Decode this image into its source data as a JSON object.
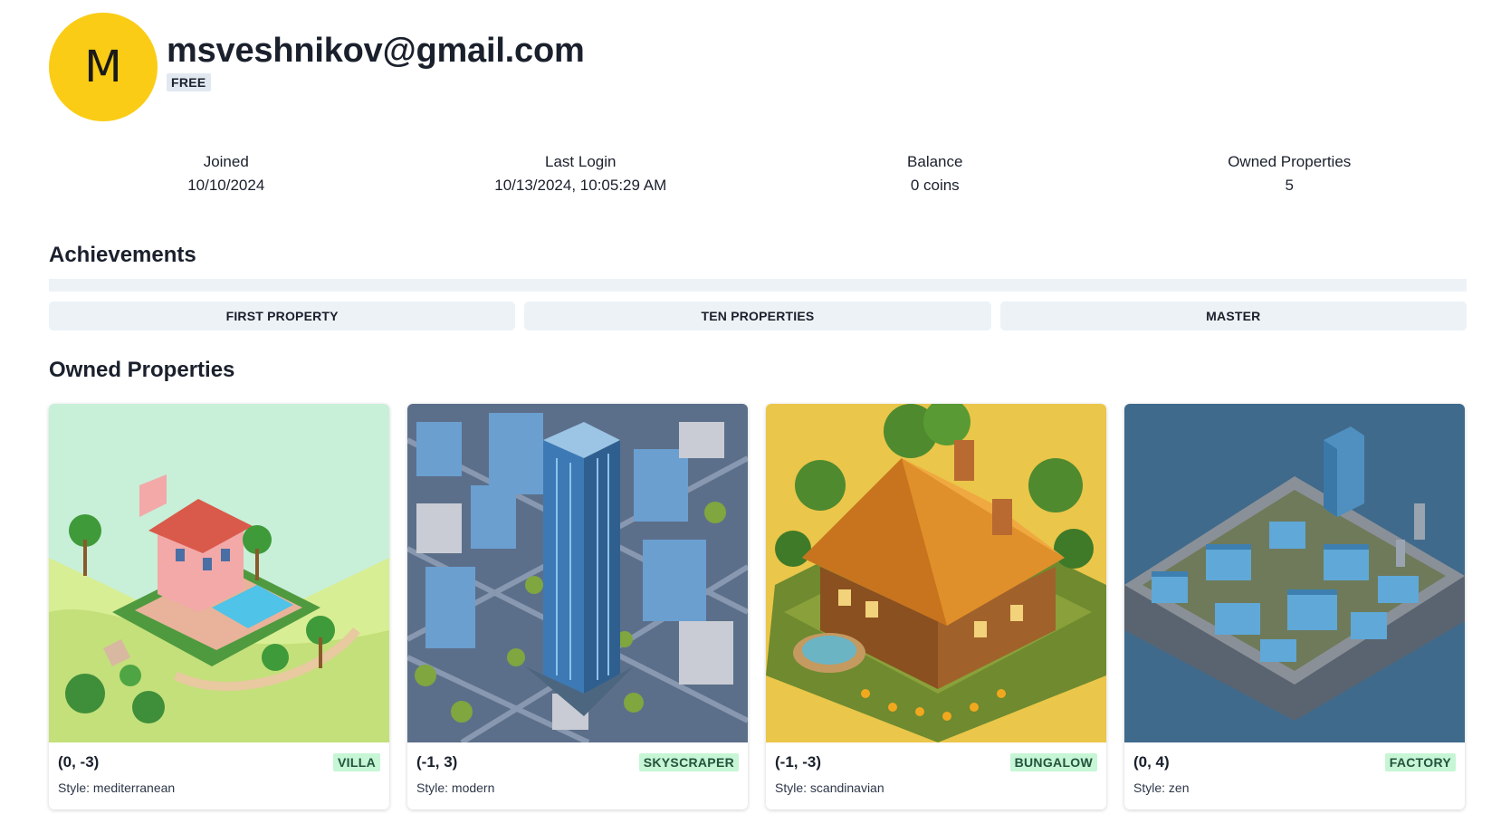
{
  "user": {
    "avatar_letter": "M",
    "email": "msveshnikov@gmail.com",
    "tier": "FREE"
  },
  "stats": [
    {
      "label": "Joined",
      "value": "10/10/2024"
    },
    {
      "label": "Last Login",
      "value": "10/13/2024, 10:05:29 AM"
    },
    {
      "label": "Balance",
      "value": "0 coins"
    },
    {
      "label": "Owned Properties",
      "value": "5"
    }
  ],
  "achievements": {
    "title": "Achievements",
    "items": [
      "FIRST PROPERTY",
      "TEN PROPERTIES",
      "MASTER"
    ]
  },
  "properties": {
    "title": "Owned Properties",
    "style_prefix": "Style: ",
    "items": [
      {
        "coords": "(0, -3)",
        "type": "VILLA",
        "style": "Style: mediterranean",
        "image": "villa-illustration"
      },
      {
        "coords": "(-1, 3)",
        "type": "SKYSCRAPER",
        "style": "Style: modern",
        "image": "skyscraper-illustration"
      },
      {
        "coords": "(-1, -3)",
        "type": "BUNGALOW",
        "style": "Style: scandinavian",
        "image": "bungalow-illustration"
      },
      {
        "coords": "(0, 4)",
        "type": "FACTORY",
        "style": "Style: zen",
        "image": "factory-illustration"
      }
    ]
  },
  "colors": {
    "avatar_bg": "#facc15",
    "badge_bg": "#e2e8f0",
    "type_badge_bg": "#c6f6d5",
    "type_badge_text": "#22543d",
    "achievement_bg": "#edf2f7"
  }
}
